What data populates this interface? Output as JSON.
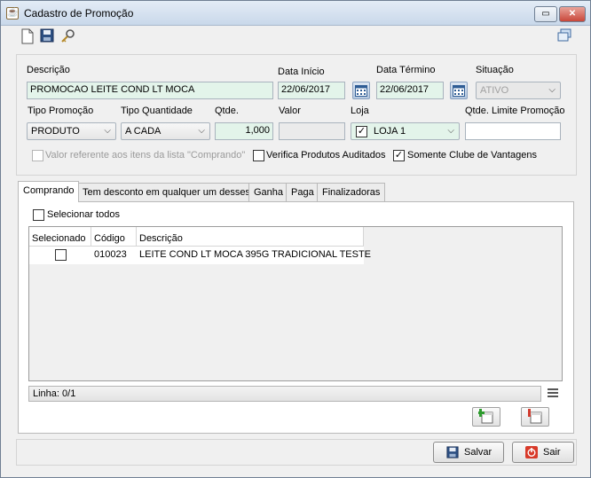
{
  "window": {
    "title": "Cadastro de Promoção"
  },
  "toolbar": {
    "icons": [
      "new-document-icon",
      "save-disk-icon",
      "search-key-icon",
      "window-copy-icon"
    ]
  },
  "form": {
    "descricao_label": "Descrição",
    "descricao_value": "PROMOCAO LEITE COND LT MOCA",
    "data_inicio_label": "Data Início",
    "data_inicio_value": "22/06/2017",
    "data_termino_label": "Data Término",
    "data_termino_value": "22/06/2017",
    "situacao_label": "Situação",
    "situacao_value": "ATIVO",
    "tipo_promocao_label": "Tipo Promoção",
    "tipo_promocao_value": "PRODUTO",
    "tipo_quantidade_label": "Tipo Quantidade",
    "tipo_quantidade_value": "A CADA",
    "qtde_label": "Qtde.",
    "qtde_value": "1,000",
    "valor_label": "Valor",
    "valor_value": "",
    "loja_label": "Loja",
    "loja_value": "LOJA 1",
    "qtde_limite_label": "Qtde. Limite Promoção",
    "qtde_limite_value": "",
    "valor_referente_label": "Valor referente aos itens da lista \"Comprando\"",
    "valor_referente_checked": false,
    "verifica_label": "Verifica Produtos Auditados",
    "verifica_checked": false,
    "somente_clube_label": "Somente Clube de Vantagens",
    "somente_clube_checked": true
  },
  "tabs": [
    {
      "label": "Comprando",
      "active": true
    },
    {
      "label": "Tem desconto em qualquer um desses",
      "active": false
    },
    {
      "label": "Ganha",
      "active": false
    },
    {
      "label": "Paga",
      "active": false
    },
    {
      "label": "Finalizadoras",
      "active": false
    }
  ],
  "comprando": {
    "selecionar_todos_label": "Selecionar todos",
    "columns": [
      "Selecionado",
      "Código",
      "Descrição"
    ],
    "rows": [
      {
        "selecionado": false,
        "codigo": "010023",
        "descricao": "LEITE COND LT MOCA 395G TRADICIONAL TESTE"
      }
    ],
    "status": "Linha: 0/1"
  },
  "buttons": {
    "salvar": "Salvar",
    "sair": "Sair"
  },
  "colors": {
    "field_green": "#e3f4ea",
    "close_red": "#c9473a",
    "window_bg": "#f0f0f0"
  }
}
